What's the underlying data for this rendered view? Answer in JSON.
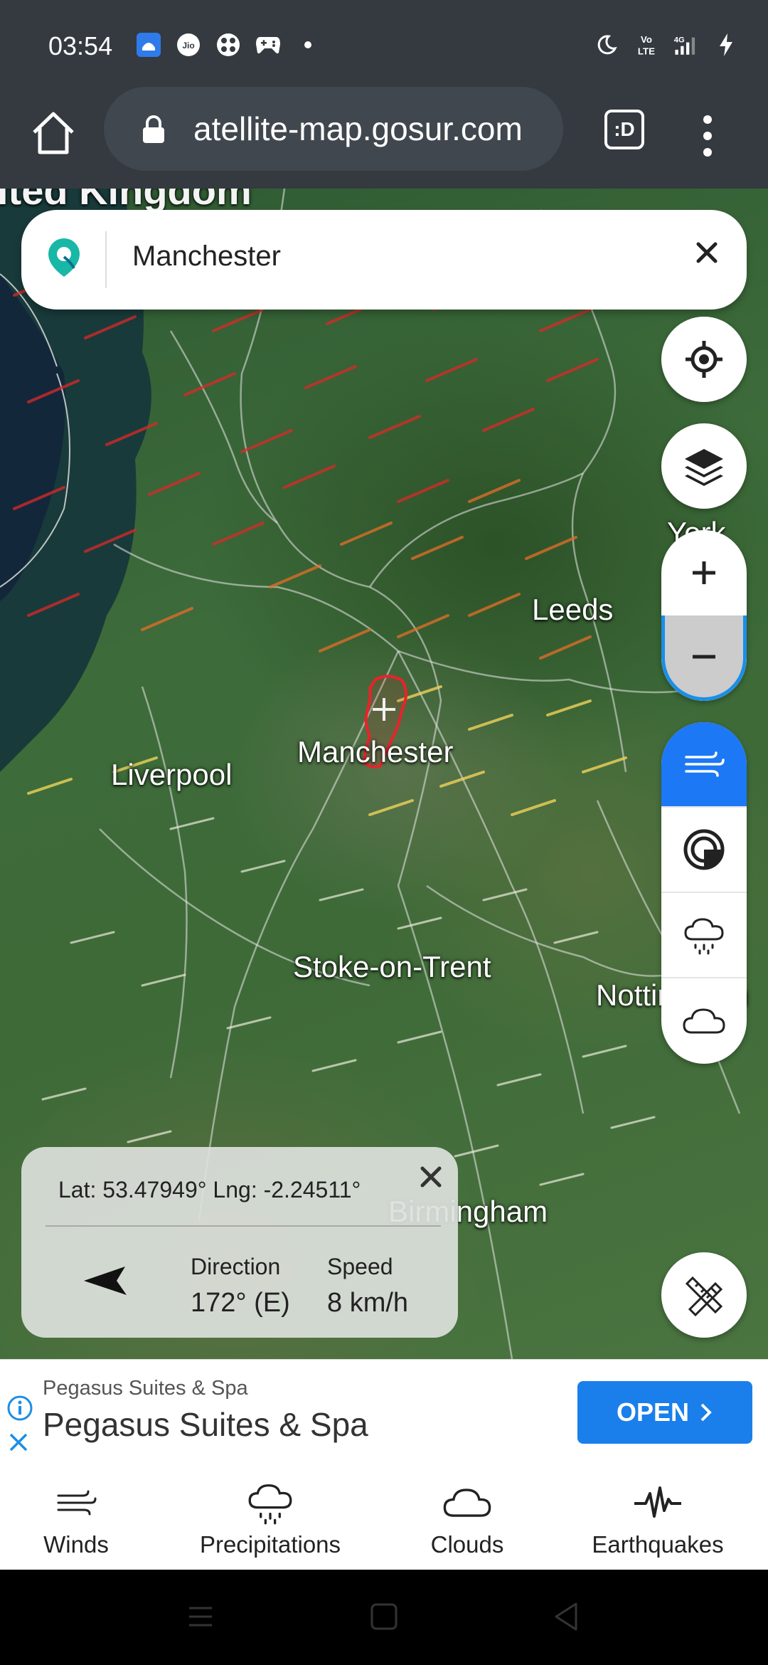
{
  "status_bar": {
    "time": "03:54",
    "icons_left": [
      "app-notification-icon",
      "jio-icon",
      "game-center-icon",
      "gamepad-icon",
      "dot-icon"
    ],
    "icons_right": [
      "moon-icon",
      "volte-icon",
      "signal-4g-icon",
      "charging-icon"
    ],
    "volte": "Vo\nLTE",
    "network": "4G"
  },
  "browser": {
    "url": "atellite-map.gosur.com",
    "tab_label": ":D"
  },
  "search": {
    "value": "Manchester"
  },
  "map": {
    "labels": {
      "region_top": "ited Kingdom",
      "york": "York",
      "leeds": "Leeds",
      "manchester": "Manchester",
      "liverpool": "Liverpool",
      "stoke": "Stoke-on-Trent",
      "nottingham": "Nottingham",
      "birmingham": "Birmingham"
    }
  },
  "info_panel": {
    "coordinates": "Lat: 53.47949°  Lng: -2.24511°",
    "direction_label": "Direction",
    "direction_value": "172° (E)",
    "speed_label": "Speed",
    "speed_value": "8 km/h"
  },
  "ad": {
    "subtitle": "Pegasus Suites & Spa",
    "title": "Pegasus Suites & Spa",
    "button": "OPEN"
  },
  "tabs": [
    {
      "label": "Winds",
      "icon": "wind-icon"
    },
    {
      "label": "Precipitations",
      "icon": "rain-cloud-icon"
    },
    {
      "label": "Clouds",
      "icon": "cloud-icon"
    },
    {
      "label": "Earthquakes",
      "icon": "seismograph-icon"
    }
  ],
  "colors": {
    "accent": "#1c78f5",
    "status_bar": "#343a40",
    "outline_red": "#e8232a"
  }
}
